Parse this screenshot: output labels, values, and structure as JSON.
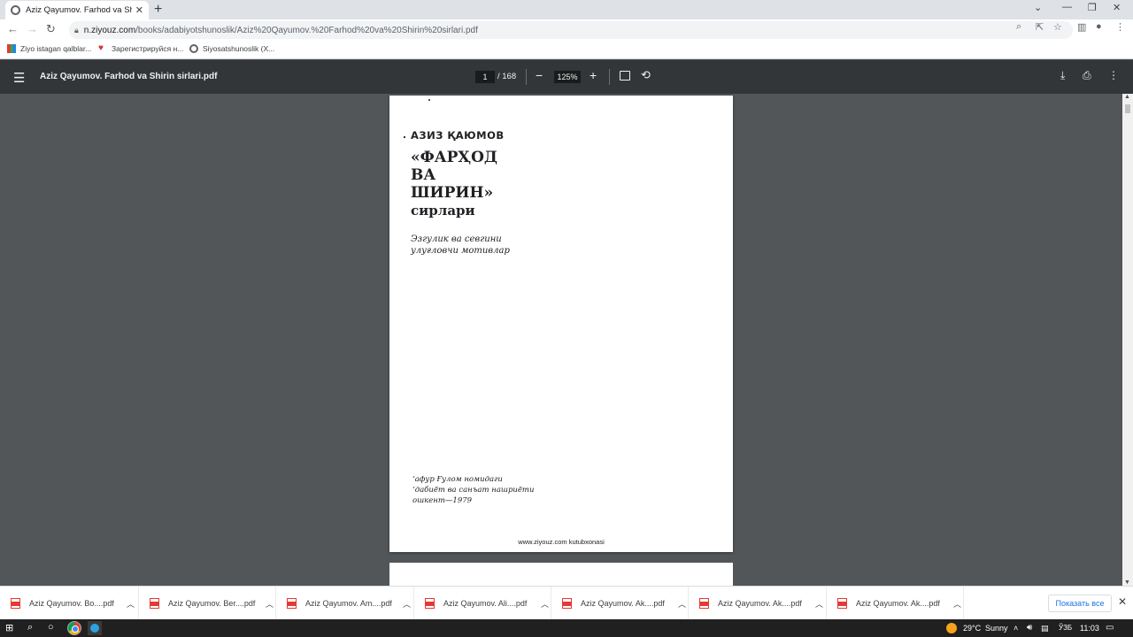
{
  "browser": {
    "tab_title": "Aziz Qayumov. Farhod va Shirin sirlari.pdf",
    "tab_title_display": "Aziz Qayumov. Farhod va Shirin",
    "url_host": "n.ziyouz.com",
    "url_path": "/books/adabiyotshunoslik/Aziz%20Qayumov.%20Farhod%20va%20Shirin%20sirlari.pdf",
    "bookmarks": [
      {
        "label": "Ziyo istagan qalblar..."
      },
      {
        "label": "Зарегистрируйся н..."
      },
      {
        "label": "Siyosatshunoslik (X..."
      }
    ]
  },
  "pdf": {
    "title": "Aziz Qayumov. Farhod va Shirin sirlari.pdf",
    "current_page": "1",
    "total_pages": "/ 168",
    "zoom": "125%",
    "page_content": {
      "author": "АЗИЗ ҚАЮМОВ",
      "title_line1": "«ФАРҲОД",
      "title_line2": "ВА",
      "title_line3": "ШИРИН»",
      "title_line4": "сирлари",
      "subtitle_line1": "Эзгулик ва севгини",
      "subtitle_line2": "улуғловчи мотивлар",
      "imprint_line1": "‘афур Ғулом номидаги",
      "imprint_line2": "‘дабиёт ва санъат нашриёти",
      "imprint_line3": "ошкент—1979",
      "footer": "www.ziyouz.com kutubxonasi"
    }
  },
  "downloads": {
    "items": [
      {
        "name": "Aziz Qayumov. Bo....pdf"
      },
      {
        "name": "Aziz Qayumov. Ber....pdf"
      },
      {
        "name": "Aziz Qayumov. Am....pdf"
      },
      {
        "name": "Aziz Qayumov. Ali....pdf"
      },
      {
        "name": "Aziz Qayumov. Ak....pdf"
      },
      {
        "name": "Aziz Qayumov. Ak....pdf"
      },
      {
        "name": "Aziz Qayumov. Ak....pdf"
      }
    ],
    "show_all": "Показать все"
  },
  "taskbar": {
    "temperature": "29°C",
    "weather": "Sunny",
    "language": "ЎЗБ",
    "time": "11:03"
  },
  "colors": {
    "pdf_toolbar": "#323639",
    "viewer_bg": "#525659",
    "link_blue": "#1a73e8",
    "pdf_red": "#e53935"
  }
}
